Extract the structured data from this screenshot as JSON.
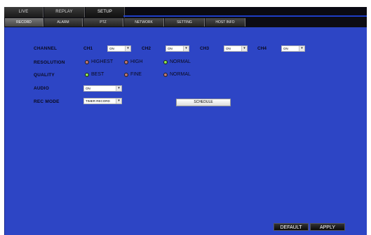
{
  "main_tabs": [
    {
      "label": "LIVE"
    },
    {
      "label": "REPLAY"
    },
    {
      "label": "SETUP"
    }
  ],
  "sub_tabs": [
    {
      "label": "RECORD"
    },
    {
      "label": "ALARM"
    },
    {
      "label": "PTZ"
    },
    {
      "label": "NETWORK"
    },
    {
      "label": "SETTING"
    },
    {
      "label": "HOST INFO"
    }
  ],
  "record": {
    "channel": {
      "label": "CHANNEL",
      "channels": [
        {
          "name": "CH1",
          "value": "ON"
        },
        {
          "name": "CH2",
          "value": "ON"
        },
        {
          "name": "CH3",
          "value": "ON"
        },
        {
          "name": "CH4",
          "value": "ON"
        }
      ]
    },
    "resolution": {
      "label": "RESOLUTION",
      "options": [
        {
          "label": "HIGHEST",
          "selected": false
        },
        {
          "label": "HIGH",
          "selected": false
        },
        {
          "label": "NORMAL",
          "selected": true
        }
      ]
    },
    "quality": {
      "label": "QUALITY",
      "options": [
        {
          "label": "BEST",
          "selected": true
        },
        {
          "label": "FINE",
          "selected": false
        },
        {
          "label": "NORMAL",
          "selected": false
        }
      ]
    },
    "audio": {
      "label": "AUDIO",
      "value": "ON"
    },
    "rec_mode": {
      "label": "REC MODE",
      "value": "TIMER RECORD"
    },
    "schedule_label": "SCHEDULE"
  },
  "footer": {
    "default_label": "DEFAULT",
    "apply_label": "APPLY"
  },
  "colors": {
    "panel": "#2d45c5",
    "radio_on": "#3aa814",
    "radio_off": "#8a4a44"
  }
}
